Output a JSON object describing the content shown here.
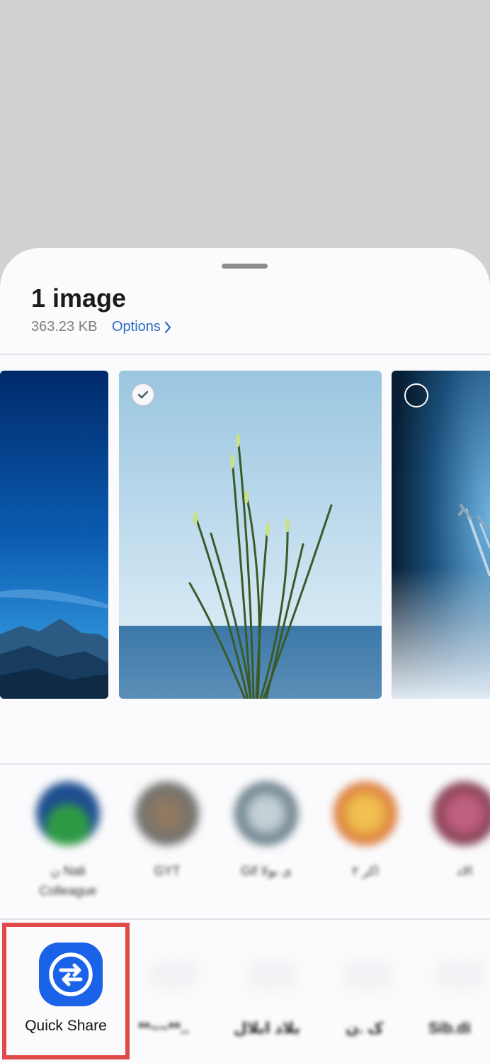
{
  "share_sheet": {
    "title": "1 image",
    "size": "363.23 KB",
    "options_label": "Options"
  },
  "thumbnails": [
    {
      "name": "mountain-night-photo",
      "selected": null
    },
    {
      "name": "grass-sea-photo",
      "selected": true
    },
    {
      "name": "jets-sky-photo",
      "selected": false
    }
  ],
  "contacts": [
    {
      "name": "ن Nali Colleague",
      "color": "#3a8f4a"
    },
    {
      "name": "GYT",
      "color": "#8a6a4a"
    },
    {
      "name": "Gif ی بولا",
      "color": "#6a7f8a"
    },
    {
      "name": "اکر ۲",
      "color": "#d8903a"
    },
    {
      "name": "الاد",
      "color": "#a03a5a"
    }
  ],
  "apps": {
    "quick_share_label": "Quick Share",
    "blurred": [
      "**~~**..",
      "بلاد ابلال",
      "ک .ن",
      "Sib.di"
    ]
  }
}
